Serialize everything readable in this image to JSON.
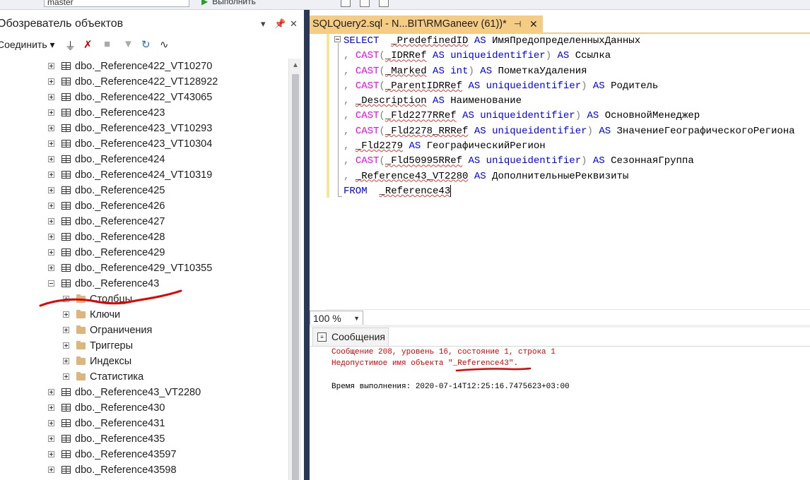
{
  "toolbar": {
    "database": "master",
    "execute_label": "Выполнить"
  },
  "object_explorer": {
    "title": "Обозреватель объектов",
    "connect_label": "Соединить",
    "items": [
      {
        "label": "dbo._Reference422_VT10270",
        "kind": "table",
        "level": 0,
        "expanded": false
      },
      {
        "label": "dbo._Reference422_VT128922",
        "kind": "table",
        "level": 0,
        "expanded": false
      },
      {
        "label": "dbo._Reference422_VT43065",
        "kind": "table",
        "level": 0,
        "expanded": false
      },
      {
        "label": "dbo._Reference423",
        "kind": "table",
        "level": 0,
        "expanded": false
      },
      {
        "label": "dbo._Reference423_VT10293",
        "kind": "table",
        "level": 0,
        "expanded": false
      },
      {
        "label": "dbo._Reference423_VT10304",
        "kind": "table",
        "level": 0,
        "expanded": false
      },
      {
        "label": "dbo._Reference424",
        "kind": "table",
        "level": 0,
        "expanded": false
      },
      {
        "label": "dbo._Reference424_VT10319",
        "kind": "table",
        "level": 0,
        "expanded": false
      },
      {
        "label": "dbo._Reference425",
        "kind": "table",
        "level": 0,
        "expanded": false
      },
      {
        "label": "dbo._Reference426",
        "kind": "table",
        "level": 0,
        "expanded": false
      },
      {
        "label": "dbo._Reference427",
        "kind": "table",
        "level": 0,
        "expanded": false
      },
      {
        "label": "dbo._Reference428",
        "kind": "table",
        "level": 0,
        "expanded": false
      },
      {
        "label": "dbo._Reference429",
        "kind": "table",
        "level": 0,
        "expanded": false
      },
      {
        "label": "dbo._Reference429_VT10355",
        "kind": "table",
        "level": 0,
        "expanded": false
      },
      {
        "label": "dbo._Reference43",
        "kind": "table",
        "level": 0,
        "expanded": true
      },
      {
        "label": "Столбцы",
        "kind": "folder",
        "level": 1,
        "expanded": false
      },
      {
        "label": "Ключи",
        "kind": "folder",
        "level": 1,
        "expanded": false
      },
      {
        "label": "Ограничения",
        "kind": "folder",
        "level": 1,
        "expanded": false
      },
      {
        "label": "Триггеры",
        "kind": "folder",
        "level": 1,
        "expanded": false
      },
      {
        "label": "Индексы",
        "kind": "folder",
        "level": 1,
        "expanded": false
      },
      {
        "label": "Статистика",
        "kind": "folder",
        "level": 1,
        "expanded": false
      },
      {
        "label": "dbo._Reference43_VT2280",
        "kind": "table",
        "level": 0,
        "expanded": false
      },
      {
        "label": "dbo._Reference430",
        "kind": "table",
        "level": 0,
        "expanded": false
      },
      {
        "label": "dbo._Reference431",
        "kind": "table",
        "level": 0,
        "expanded": false
      },
      {
        "label": "dbo._Reference435",
        "kind": "table",
        "level": 0,
        "expanded": false
      },
      {
        "label": "dbo._Reference43597",
        "kind": "table",
        "level": 0,
        "expanded": false
      },
      {
        "label": "dbo._Reference43598",
        "kind": "table",
        "level": 0,
        "expanded": false
      }
    ]
  },
  "editor": {
    "tab_title": "SQLQuery2.sql - N...BIT\\RMGaneev (61))*",
    "code_lines": [
      [
        {
          "t": "SELECT",
          "c": "kw"
        },
        {
          "t": "  ",
          "c": "plain"
        },
        {
          "t": "_PredefinedID",
          "c": "id"
        },
        {
          "t": " ",
          "c": "plain"
        },
        {
          "t": "AS",
          "c": "kw"
        },
        {
          "t": " ИмяПредопределенныхДанных",
          "c": "plain"
        }
      ],
      [
        {
          "t": ", ",
          "c": "gr"
        },
        {
          "t": "CAST",
          "c": "fn"
        },
        {
          "t": "(",
          "c": "gr"
        },
        {
          "t": "_IDRRef",
          "c": "id"
        },
        {
          "t": " ",
          "c": "plain"
        },
        {
          "t": "AS",
          "c": "kw"
        },
        {
          "t": " ",
          "c": "plain"
        },
        {
          "t": "uniqueidentifier",
          "c": "kw"
        },
        {
          "t": ")",
          "c": "gr"
        },
        {
          "t": " ",
          "c": "plain"
        },
        {
          "t": "AS",
          "c": "kw"
        },
        {
          "t": " Ссылка",
          "c": "plain"
        }
      ],
      [
        {
          "t": ", ",
          "c": "gr"
        },
        {
          "t": "CAST",
          "c": "fn"
        },
        {
          "t": "(",
          "c": "gr"
        },
        {
          "t": "_Marked",
          "c": "id"
        },
        {
          "t": " ",
          "c": "plain"
        },
        {
          "t": "AS",
          "c": "kw"
        },
        {
          "t": " ",
          "c": "plain"
        },
        {
          "t": "int",
          "c": "kw"
        },
        {
          "t": ")",
          "c": "gr"
        },
        {
          "t": " ",
          "c": "plain"
        },
        {
          "t": "AS",
          "c": "kw"
        },
        {
          "t": " ПометкаУдаления",
          "c": "plain"
        }
      ],
      [
        {
          "t": ", ",
          "c": "gr"
        },
        {
          "t": "CAST",
          "c": "fn"
        },
        {
          "t": "(",
          "c": "gr"
        },
        {
          "t": "_ParentIDRRef",
          "c": "id"
        },
        {
          "t": " ",
          "c": "plain"
        },
        {
          "t": "AS",
          "c": "kw"
        },
        {
          "t": " ",
          "c": "plain"
        },
        {
          "t": "uniqueidentifier",
          "c": "kw"
        },
        {
          "t": ")",
          "c": "gr"
        },
        {
          "t": " ",
          "c": "plain"
        },
        {
          "t": "AS",
          "c": "kw"
        },
        {
          "t": " Родитель",
          "c": "plain"
        }
      ],
      [
        {
          "t": ", ",
          "c": "gr"
        },
        {
          "t": "_Description",
          "c": "id"
        },
        {
          "t": " ",
          "c": "plain"
        },
        {
          "t": "AS",
          "c": "kw"
        },
        {
          "t": " Наименование",
          "c": "plain"
        }
      ],
      [
        {
          "t": ", ",
          "c": "gr"
        },
        {
          "t": "CAST",
          "c": "fn"
        },
        {
          "t": "(",
          "c": "gr"
        },
        {
          "t": "_Fld2277RRef",
          "c": "id"
        },
        {
          "t": " ",
          "c": "plain"
        },
        {
          "t": "AS",
          "c": "kw"
        },
        {
          "t": " ",
          "c": "plain"
        },
        {
          "t": "uniqueidentifier",
          "c": "kw"
        },
        {
          "t": ")",
          "c": "gr"
        },
        {
          "t": " ",
          "c": "plain"
        },
        {
          "t": "AS",
          "c": "kw"
        },
        {
          "t": " ОсновнойМенеджер",
          "c": "plain"
        }
      ],
      [
        {
          "t": ", ",
          "c": "gr"
        },
        {
          "t": "CAST",
          "c": "fn"
        },
        {
          "t": "(",
          "c": "gr"
        },
        {
          "t": "_Fld2278_RRRef",
          "c": "id"
        },
        {
          "t": " ",
          "c": "plain"
        },
        {
          "t": "AS",
          "c": "kw"
        },
        {
          "t": " ",
          "c": "plain"
        },
        {
          "t": "uniqueidentifier",
          "c": "kw"
        },
        {
          "t": ")",
          "c": "gr"
        },
        {
          "t": " ",
          "c": "plain"
        },
        {
          "t": "AS",
          "c": "kw"
        },
        {
          "t": " ЗначениеГеографическогоРегиона",
          "c": "plain"
        }
      ],
      [
        {
          "t": ", ",
          "c": "gr"
        },
        {
          "t": "_Fld2279",
          "c": "id"
        },
        {
          "t": " ",
          "c": "plain"
        },
        {
          "t": "AS",
          "c": "kw"
        },
        {
          "t": " ГеографическийРегион",
          "c": "plain"
        }
      ],
      [
        {
          "t": ", ",
          "c": "gr"
        },
        {
          "t": "CAST",
          "c": "fn"
        },
        {
          "t": "(",
          "c": "gr"
        },
        {
          "t": "_Fld50995RRef",
          "c": "id"
        },
        {
          "t": " ",
          "c": "plain"
        },
        {
          "t": "AS",
          "c": "kw"
        },
        {
          "t": " ",
          "c": "plain"
        },
        {
          "t": "uniqueidentifier",
          "c": "kw"
        },
        {
          "t": ")",
          "c": "gr"
        },
        {
          "t": " ",
          "c": "plain"
        },
        {
          "t": "AS",
          "c": "kw"
        },
        {
          "t": " СезоннаяГруппа",
          "c": "plain"
        }
      ],
      [
        {
          "t": ", ",
          "c": "gr"
        },
        {
          "t": "_Reference43_VT2280",
          "c": "id"
        },
        {
          "t": " ",
          "c": "plain"
        },
        {
          "t": "AS",
          "c": "kw"
        },
        {
          "t": " ДополнительныеРеквизиты",
          "c": "plain"
        }
      ],
      [
        {
          "t": "FROM",
          "c": "kw"
        },
        {
          "t": "  ",
          "c": "plain"
        },
        {
          "t": "_Reference43",
          "c": "id"
        },
        {
          "t": "",
          "c": "caret"
        }
      ]
    ]
  },
  "zoom": {
    "value": "100 %"
  },
  "results": {
    "tab_label": "Сообщения",
    "error_line1": "Сообщение 208, уровень 16, состояние 1, строка 1",
    "error_line2": "Недопустимое имя объекта \"_Reference43\".",
    "time_line": "Время выполнения: 2020-07-14T12:25:16.7475623+03:00"
  },
  "colors": {
    "active_tab": "#f5cc84",
    "keyword": "#0000ff",
    "function": "#ff00ff",
    "error_text": "#e00000",
    "annotation": "#e60000"
  }
}
